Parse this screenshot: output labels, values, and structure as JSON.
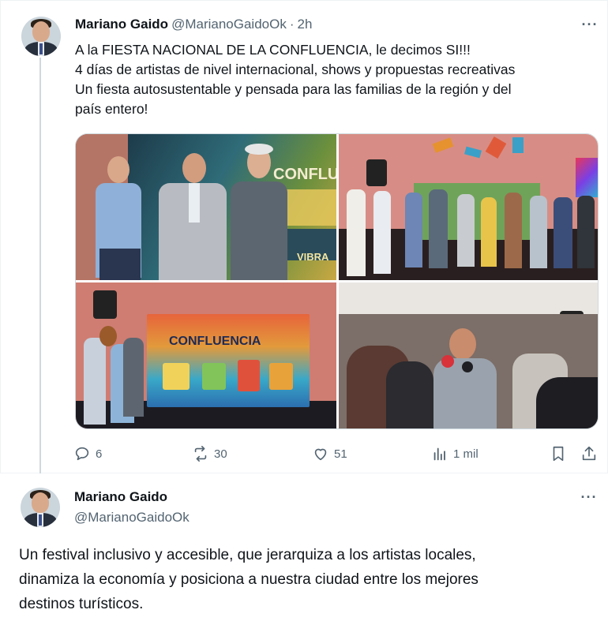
{
  "tweet1": {
    "author_name": "Mariano Gaido",
    "author_handle": "@MarianoGaidoOk",
    "separator": "·",
    "time": "2h",
    "text_lines": [
      "A la FIESTA NACIONAL DE LA CONFLUENCIA, le decimos SI!!!",
      "4 días de artistas de nivel internacional, shows y propuestas recreativas",
      "Un fiesta autosustentable y pensada para las familias de la región y del",
      "país entero!"
    ],
    "media_text": {
      "poster_title": "CONFLUENCIA",
      "poster_word": "VIBRA",
      "stage_title": "CONFLUENCIA"
    },
    "actions": {
      "replies": "6",
      "reposts": "30",
      "likes": "51",
      "views": "1 mil"
    },
    "more_label": "···"
  },
  "tweet2": {
    "author_name": "Mariano Gaido",
    "author_handle": "@MarianoGaidoOk",
    "text_lines": [
      "Un festival inclusivo y accesible, que jerarquiza a los artistas locales,",
      "dinamiza la economía y posiciona a nuestra ciudad entre los mejores",
      "destinos turísticos."
    ],
    "more_label": "···"
  },
  "colors": {
    "text": "#0f1419",
    "muted": "#536471",
    "border": "#eff3f4",
    "thread_line": "#cfd9de"
  },
  "icons": [
    "reply-icon",
    "repost-icon",
    "like-icon",
    "views-icon",
    "bookmark-icon",
    "share-icon",
    "more-icon"
  ]
}
